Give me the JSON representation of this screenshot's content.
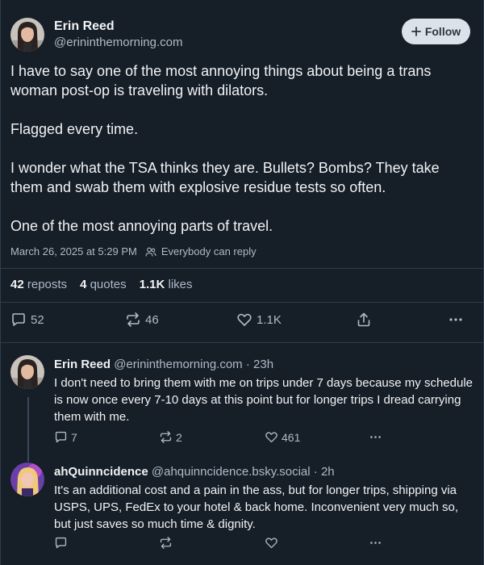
{
  "post": {
    "author": {
      "display_name": "Erin Reed",
      "handle": "@erininthemorning.com"
    },
    "follow_label": "Follow",
    "paragraphs": [
      "I have to say one of the most annoying things about being a trans woman post-op is traveling with dilators.",
      "Flagged every time.",
      "I wonder what the TSA thinks they are. Bullets? Bombs? They take them and swab them with explosive residue tests so often.",
      "One of the most annoying parts of travel."
    ],
    "timestamp": "March 26, 2025 at 5:29 PM",
    "reply_setting": "Everybody can reply",
    "stats": {
      "reposts_count": "42",
      "reposts_label": "reposts",
      "quotes_count": "4",
      "quotes_label": "quotes",
      "likes_count": "1.1K",
      "likes_label": "likes"
    },
    "actions": {
      "replies": "52",
      "reposts": "46",
      "likes": "1.1K"
    }
  },
  "replies": [
    {
      "display_name": "Erin Reed",
      "handle": "@erininthemorning.com",
      "age": "· 23h",
      "text": "I don't need to bring them with me on trips under 7 days because my schedule is now once every 7-10 days at this point but for longer trips I dread carrying them with me.",
      "replies": "7",
      "reposts": "2",
      "likes": "461"
    },
    {
      "display_name": "ahQuinncidence",
      "handle": "@ahquinncidence.bsky.social",
      "age": "· 2h",
      "text": "It's an additional cost and a pain in the ass, but for longer trips, shipping via USPS, UPS, FedEx to your hotel & back home. Inconvenient very much so, but just saves so much time & dignity.",
      "replies": "",
      "reposts": "",
      "likes": ""
    }
  ],
  "colors": {
    "background": "#161e27",
    "text_primary": "#f1f3f5",
    "text_secondary": "#aebbc9",
    "divider": "#2e3d4d",
    "follow_button_bg": "#dce2ea"
  }
}
